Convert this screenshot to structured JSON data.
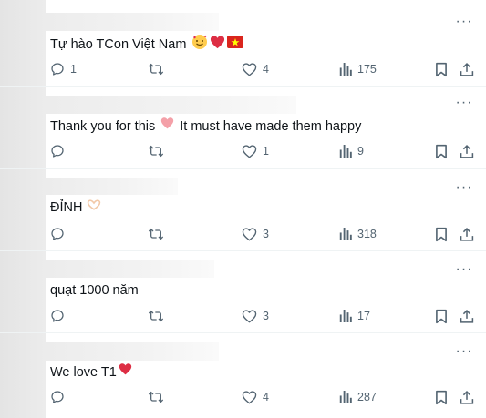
{
  "colors": {
    "icon": "#536471",
    "text": "#0f1419",
    "divider": "#eff3f4",
    "heart_red": "#e0245e",
    "pink_heart": "#f4a0a8"
  },
  "more_label": "···",
  "posts": [
    {
      "text": "Tự hào TCon Việt Nam",
      "emoji": [
        "smiling-face-with-hearts",
        "red-heart",
        "vietnam-flag"
      ],
      "replies": "1",
      "reposts": "",
      "likes": "4",
      "views": "175"
    },
    {
      "text": "Thank you for this",
      "text_after": "It must have made them happy",
      "emoji": [
        "pink-heart"
      ],
      "replies": "",
      "reposts": "",
      "likes": "1",
      "views": "9"
    },
    {
      "text": "ĐỈNH",
      "emoji": [
        "heart-hands"
      ],
      "replies": "",
      "reposts": "",
      "likes": "3",
      "views": "318"
    },
    {
      "text": "quạt 1000 năm",
      "emoji": [],
      "replies": "",
      "reposts": "",
      "likes": "3",
      "views": "17"
    },
    {
      "text": "We love T1",
      "emoji": [
        "red-heart"
      ],
      "replies": "",
      "reposts": "",
      "likes": "4",
      "views": "287"
    }
  ]
}
